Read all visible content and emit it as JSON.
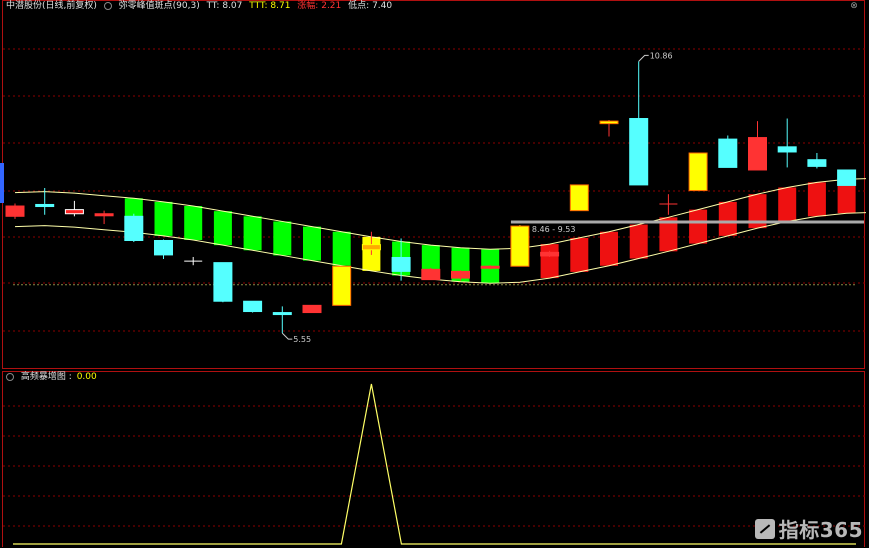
{
  "main": {
    "stock_name": "中潜股份(日线,前复权)",
    "indicator_name": "弥零峰值斑点(90,3)",
    "tt_label": "TT:",
    "tt_value": "8.07",
    "ttt_label": "TTT:",
    "ttt_value": "8.71",
    "rise_label": "涨幅:",
    "rise_value": "2.21",
    "point_label": "低点:",
    "point_value": "7.40",
    "high_label": "10.86",
    "low_label": "5.55",
    "range_label": "8.46 - 9.53"
  },
  "sub": {
    "indicator_name": "高频暴增图",
    "value": "0.00"
  },
  "watermark": {
    "text": "指标365"
  },
  "colors": {
    "up": "#ff3333",
    "down": "#55ffff",
    "yellow": "#ffff00",
    "green": "#00ff00",
    "grid": "#8b0000",
    "line": "#ffff66"
  },
  "chart_data": {
    "type": "candlestick",
    "ylim": [
      5.0,
      11.8
    ],
    "candles": [
      {
        "o": 8.05,
        "h": 8.1,
        "l": 7.8,
        "c": 7.85,
        "color": "up"
      },
      {
        "o": 8.08,
        "h": 8.4,
        "l": 7.88,
        "c": 8.04,
        "color": "down"
      },
      {
        "o": 7.98,
        "h": 8.15,
        "l": 7.85,
        "c": 7.9,
        "color": "up_box"
      },
      {
        "o": 7.9,
        "h": 7.96,
        "l": 7.7,
        "c": 7.86,
        "color": "up"
      },
      {
        "o": 7.85,
        "h": 7.9,
        "l": 7.35,
        "c": 7.38,
        "color": "down"
      },
      {
        "o": 7.38,
        "h": 7.4,
        "l": 7.02,
        "c": 7.1,
        "color": "down"
      },
      {
        "o": 6.96,
        "h": 7.06,
        "l": 6.9,
        "c": 6.98,
        "color": "cross"
      },
      {
        "o": 6.95,
        "h": 6.95,
        "l": 6.18,
        "c": 6.2,
        "color": "down"
      },
      {
        "o": 6.2,
        "h": 6.2,
        "l": 5.98,
        "c": 6.0,
        "color": "down"
      },
      {
        "o": 5.98,
        "h": 6.1,
        "l": 5.58,
        "c": 5.95,
        "color": "down"
      },
      {
        "o": 5.98,
        "h": 6.12,
        "l": 5.98,
        "c": 6.12,
        "color": "up"
      },
      {
        "o": 6.12,
        "h": 6.88,
        "l": 6.12,
        "c": 6.88,
        "color": "yellow"
      },
      {
        "o": 7.2,
        "h": 7.55,
        "l": 7.1,
        "c": 7.3,
        "color": "yellow_orange"
      },
      {
        "o": 7.05,
        "h": 7.42,
        "l": 6.6,
        "c": 6.78,
        "color": "down"
      },
      {
        "o": 6.62,
        "h": 6.85,
        "l": 6.62,
        "c": 6.82,
        "color": "up"
      },
      {
        "o": 6.65,
        "h": 6.8,
        "l": 6.6,
        "c": 6.78,
        "color": "up"
      },
      {
        "o": 6.86,
        "h": 6.9,
        "l": 6.82,
        "c": 6.88,
        "color": "up"
      },
      {
        "o": 6.88,
        "h": 7.68,
        "l": 6.88,
        "c": 7.66,
        "color": "yellow"
      },
      {
        "o": 7.08,
        "h": 7.18,
        "l": 7.06,
        "c": 7.15,
        "color": "up"
      },
      {
        "o": 7.96,
        "h": 8.46,
        "l": 7.96,
        "c": 8.46,
        "color": "yellow"
      },
      {
        "o": 9.65,
        "h": 9.72,
        "l": 9.4,
        "c": 9.7,
        "color": "yellow_bar"
      },
      {
        "o": 9.75,
        "h": 10.86,
        "l": 8.46,
        "c": 8.46,
        "color": "down"
      },
      {
        "o": 8.09,
        "h": 8.28,
        "l": 7.88,
        "c": 8.09,
        "color": "cross_red"
      },
      {
        "o": 8.35,
        "h": 9.08,
        "l": 8.35,
        "c": 9.08,
        "color": "yellow"
      },
      {
        "o": 9.35,
        "h": 9.42,
        "l": 8.8,
        "c": 8.8,
        "color": "down"
      },
      {
        "o": 8.75,
        "h": 9.7,
        "l": 8.75,
        "c": 9.38,
        "color": "up"
      },
      {
        "o": 9.2,
        "h": 9.75,
        "l": 8.8,
        "c": 9.1,
        "color": "down"
      },
      {
        "o": 8.95,
        "h": 9.08,
        "l": 8.78,
        "c": 8.82,
        "color": "down"
      },
      {
        "o": 8.75,
        "h": 8.75,
        "l": 8.45,
        "c": 8.45,
        "color": "down"
      },
      {
        "o": 8.1,
        "h": 8.3,
        "l": 7.9,
        "c": 8.28,
        "color": "up"
      }
    ],
    "ribbon": [
      {
        "mid": 7.98,
        "color": "none"
      },
      {
        "mid": 8.0,
        "color": "none"
      },
      {
        "mid": 7.97,
        "color": "none"
      },
      {
        "mid": 7.92,
        "color": "none"
      },
      {
        "mid": 7.87,
        "color": "green"
      },
      {
        "mid": 7.8,
        "color": "green"
      },
      {
        "mid": 7.72,
        "color": "green"
      },
      {
        "mid": 7.62,
        "color": "green"
      },
      {
        "mid": 7.52,
        "color": "green"
      },
      {
        "mid": 7.42,
        "color": "green"
      },
      {
        "mid": 7.32,
        "color": "green"
      },
      {
        "mid": 7.22,
        "color": "green"
      },
      {
        "mid": 7.12,
        "color": "yellow"
      },
      {
        "mid": 7.03,
        "color": "green"
      },
      {
        "mid": 6.96,
        "color": "green"
      },
      {
        "mid": 6.91,
        "color": "green"
      },
      {
        "mid": 6.88,
        "color": "green"
      },
      {
        "mid": 6.9,
        "color": "none"
      },
      {
        "mid": 6.98,
        "color": "red"
      },
      {
        "mid": 7.1,
        "color": "red"
      },
      {
        "mid": 7.22,
        "color": "red"
      },
      {
        "mid": 7.36,
        "color": "red"
      },
      {
        "mid": 7.5,
        "color": "red"
      },
      {
        "mid": 7.65,
        "color": "red"
      },
      {
        "mid": 7.8,
        "color": "red"
      },
      {
        "mid": 7.95,
        "color": "red"
      },
      {
        "mid": 8.08,
        "color": "red"
      },
      {
        "mid": 8.18,
        "color": "red"
      },
      {
        "mid": 8.24,
        "color": "red"
      },
      {
        "mid": 8.26,
        "color": "red"
      }
    ],
    "resistance_level": 7.74,
    "support_level": 6.52,
    "spike": {
      "x_index": 12,
      "value": 1.0
    }
  }
}
